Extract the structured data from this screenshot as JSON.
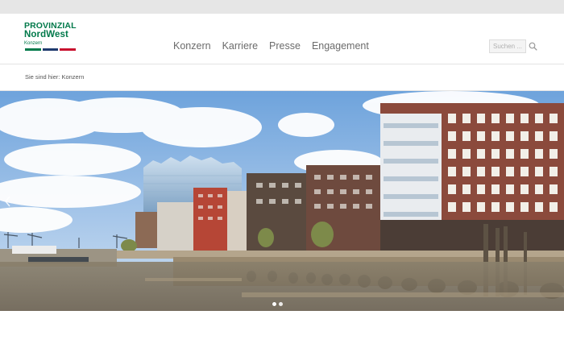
{
  "logo": {
    "line1": "PROVINZIAL",
    "line2": "NordWest",
    "line3": "Konzern",
    "colors": [
      "#00794a",
      "#1e3a6e",
      "#c8102e"
    ]
  },
  "nav": {
    "items": [
      {
        "label": "Konzern"
      },
      {
        "label": "Karriere"
      },
      {
        "label": "Presse"
      },
      {
        "label": "Engagement"
      }
    ]
  },
  "search": {
    "placeholder": "Suchen ...",
    "icon": "search-icon"
  },
  "breadcrumb": {
    "text": "Sie sind hier: Konzern"
  },
  "hero": {
    "image": "hamburg-hafencity-elbphilharmonie",
    "slides_total": 2,
    "active_slide": 1
  },
  "colors": {
    "brand_green": "#00794a",
    "topbar": "#e6e6e6",
    "nav_text": "#6b6b6b"
  }
}
